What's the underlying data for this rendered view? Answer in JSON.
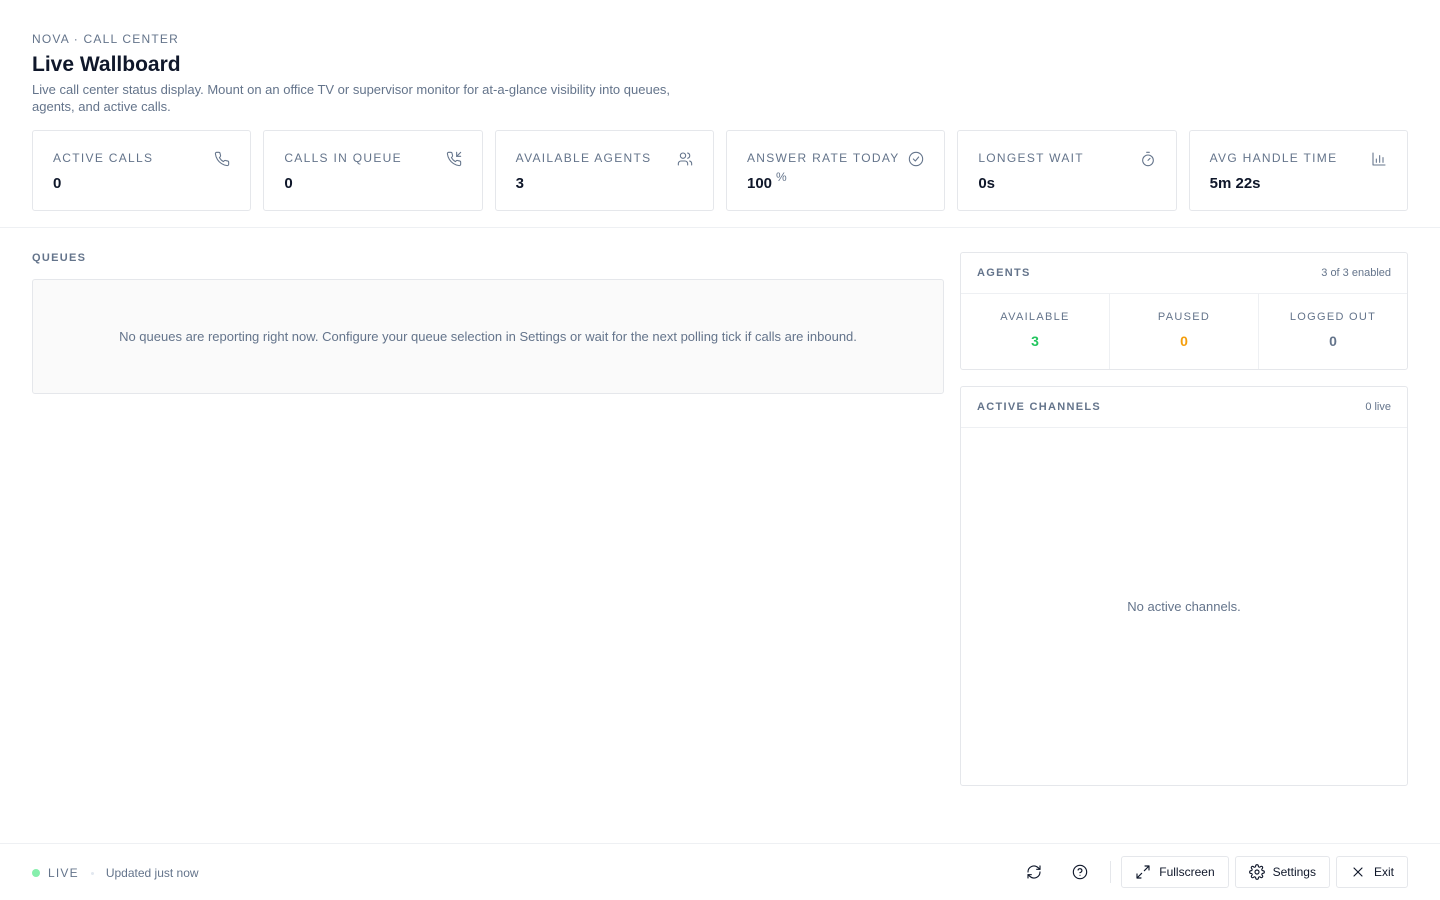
{
  "header": {
    "eyebrow": "NOVA · CALL CENTER",
    "title": "Live Wallboard",
    "subtitle": "Live call center status display. Mount on an office TV or supervisor monitor for at-a-glance visibility into queues, agents, and active calls."
  },
  "stats": [
    {
      "label": "ACTIVE CALLS",
      "value": "0",
      "icon": "phone-icon"
    },
    {
      "label": "CALLS IN QUEUE",
      "value": "0",
      "icon": "phone-incoming-icon"
    },
    {
      "label": "AVAILABLE AGENTS",
      "value": "3",
      "icon": "users-icon"
    },
    {
      "label": "ANSWER RATE TODAY",
      "value": "100",
      "unit": "%",
      "icon": "check-circle-icon"
    },
    {
      "label": "LONGEST WAIT",
      "value": "0s",
      "icon": "timer-icon"
    },
    {
      "label": "AVG HANDLE TIME",
      "value": "5m 22s",
      "icon": "bar-chart-icon"
    }
  ],
  "queues": {
    "label": "QUEUES",
    "empty_text": "No queues are reporting right now. Configure your queue selection in Settings or wait for the next polling tick if calls are inbound."
  },
  "agents": {
    "label": "AGENTS",
    "meta": "3 of 3 enabled",
    "columns": [
      {
        "label": "AVAILABLE",
        "value": "3",
        "color": "#22c55e"
      },
      {
        "label": "PAUSED",
        "value": "0",
        "color": "#f59e0b"
      },
      {
        "label": "LOGGED OUT",
        "value": "0",
        "color": "#64748b"
      }
    ]
  },
  "channels": {
    "label": "ACTIVE CHANNELS",
    "meta": "0 live",
    "empty_text": "No active channels."
  },
  "footer": {
    "live_label": "LIVE",
    "live_color": "#86efac",
    "updated": "Updated just now",
    "refresh_icon": "refresh-icon",
    "help_icon": "help-icon",
    "fullscreen_label": "Fullscreen",
    "settings_label": "Settings",
    "exit_label": "Exit"
  }
}
